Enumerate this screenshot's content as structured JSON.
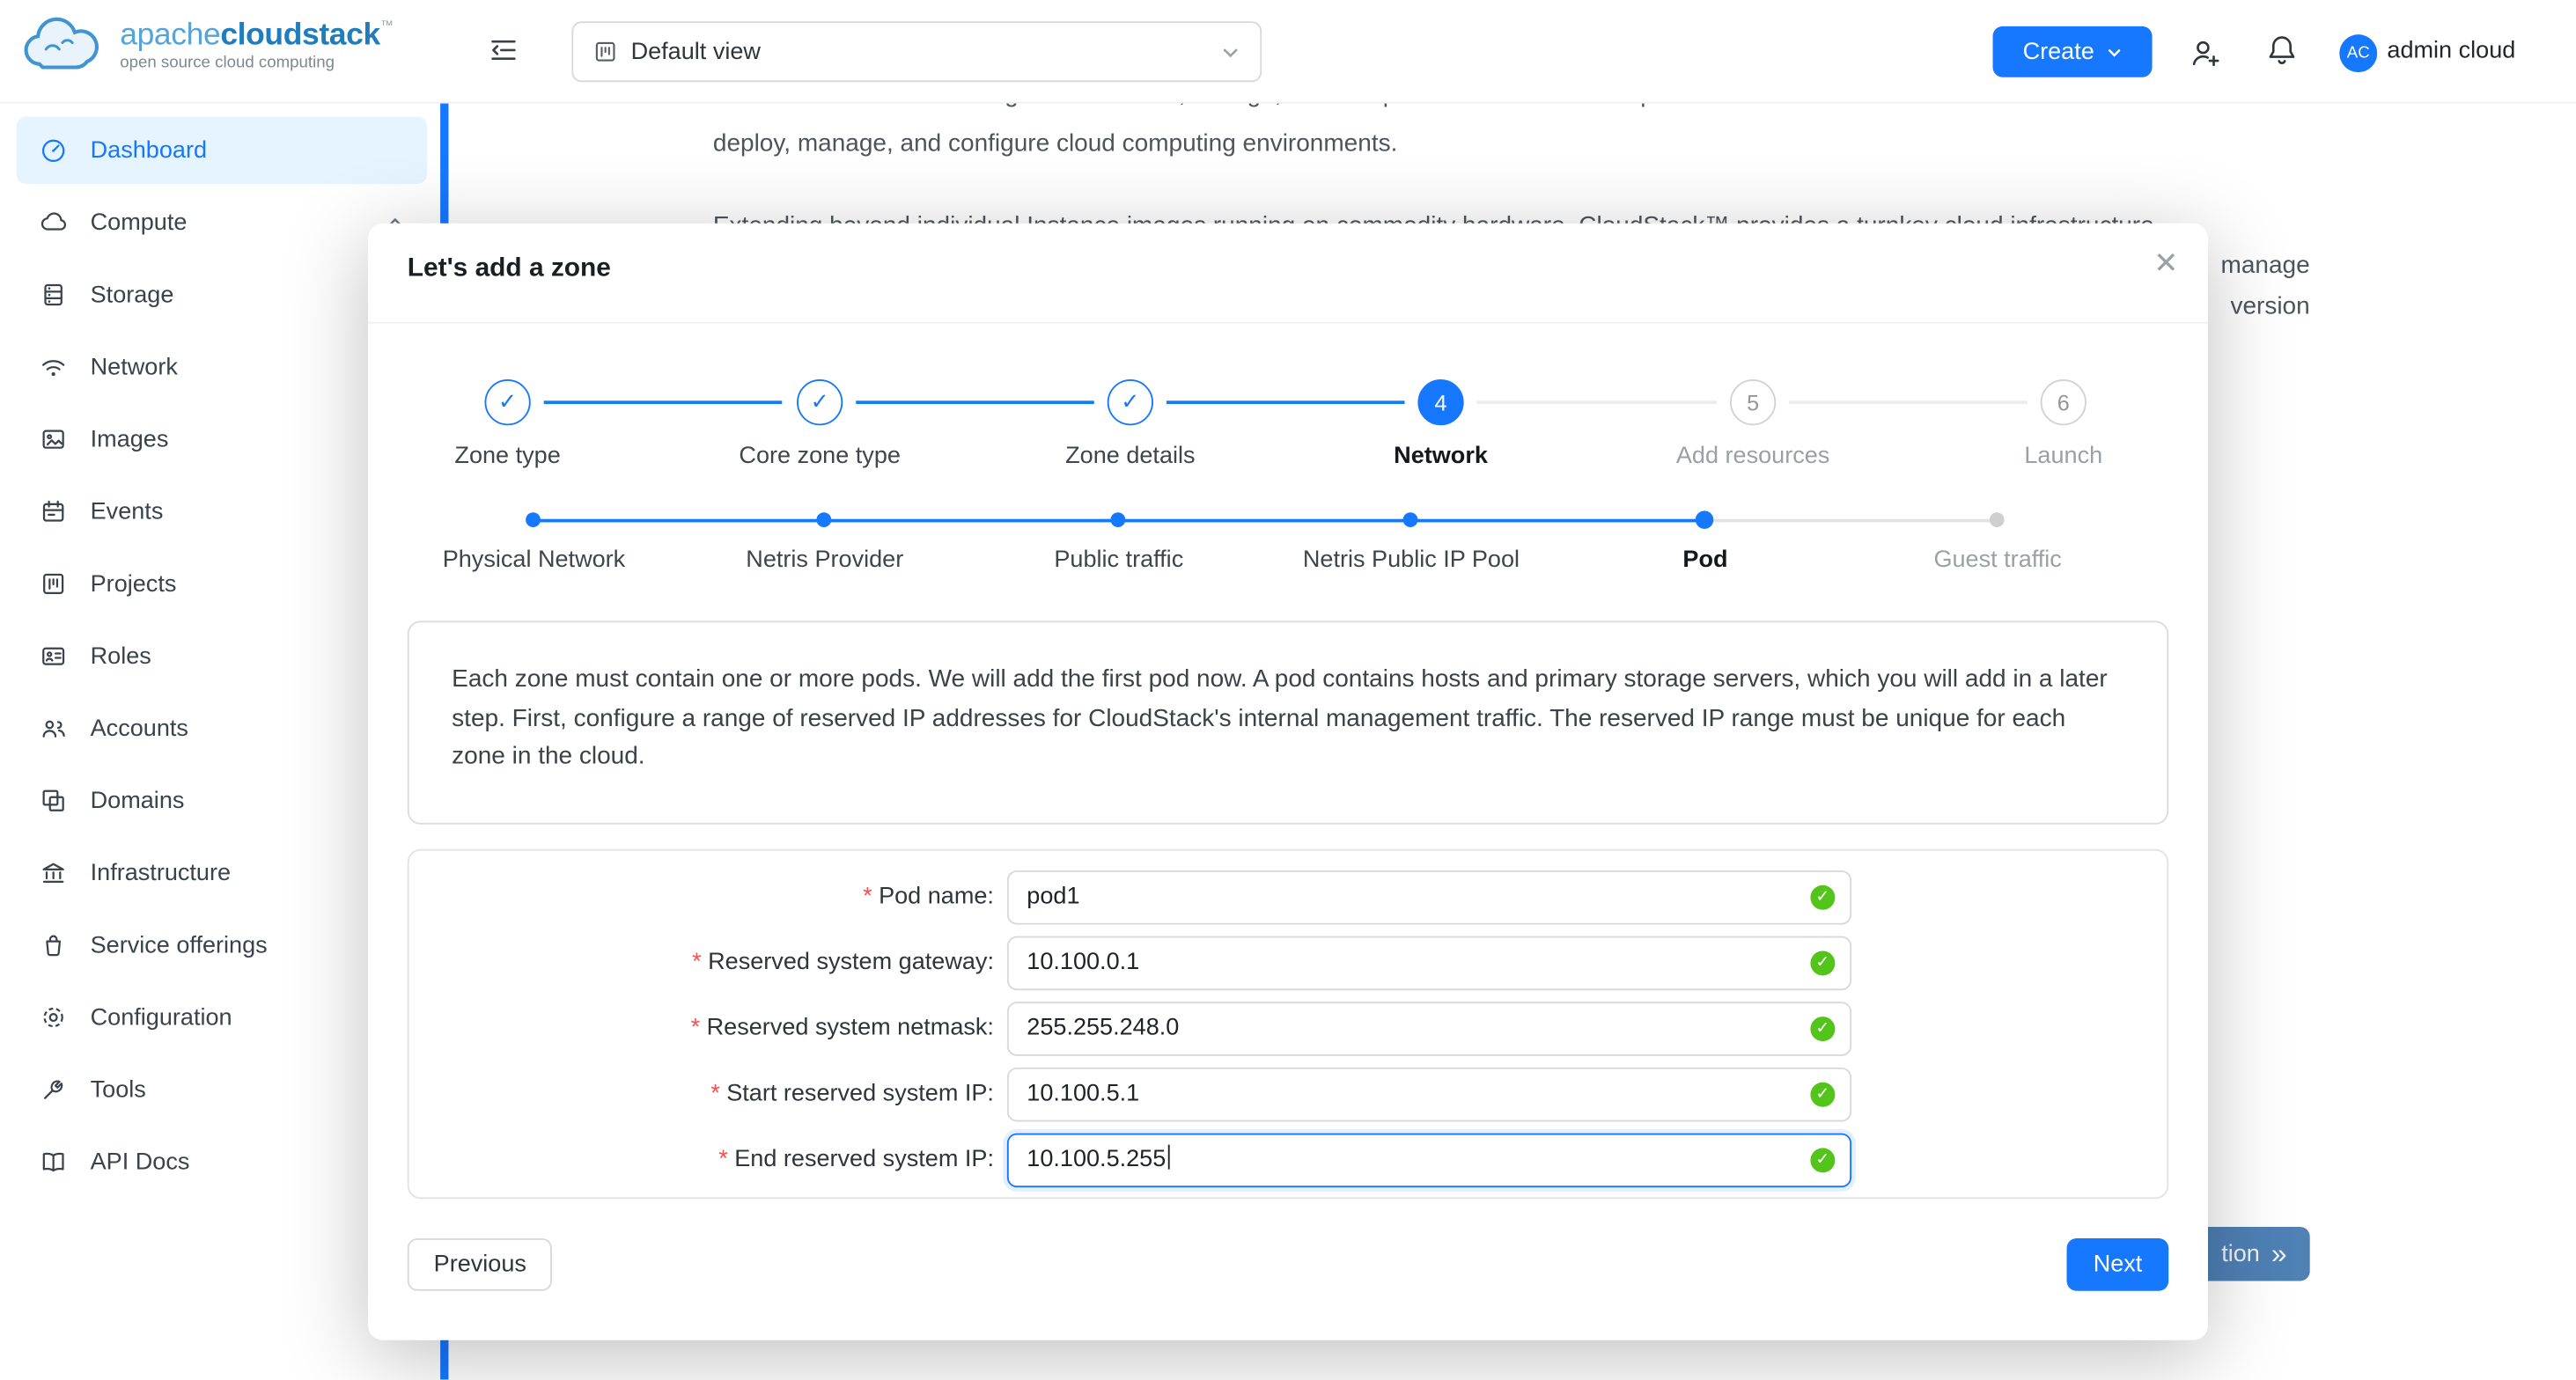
{
  "header": {
    "logo": {
      "apache": "apache",
      "cloudstack": "cloudstack",
      "tm": "™",
      "tagline": "open source cloud computing"
    },
    "view_select": {
      "value": "Default view"
    },
    "create_label": "Create",
    "user": {
      "initials": "AC",
      "name": "admin cloud"
    }
  },
  "sidebar": {
    "items": [
      {
        "label": "Dashboard",
        "icon": "dashboard-icon",
        "active": true
      },
      {
        "label": "Compute",
        "icon": "cloud-icon",
        "expandable": true
      },
      {
        "label": "Storage",
        "icon": "database-icon"
      },
      {
        "label": "Network",
        "icon": "wifi-icon"
      },
      {
        "label": "Images",
        "icon": "picture-icon"
      },
      {
        "label": "Events",
        "icon": "calendar-icon"
      },
      {
        "label": "Projects",
        "icon": "project-icon"
      },
      {
        "label": "Roles",
        "icon": "idcard-icon"
      },
      {
        "label": "Accounts",
        "icon": "team-icon"
      },
      {
        "label": "Domains",
        "icon": "block-icon"
      },
      {
        "label": "Infrastructure",
        "icon": "bank-icon"
      },
      {
        "label": "Service offerings",
        "icon": "bag-icon"
      },
      {
        "label": "Configuration",
        "icon": "gear-icon"
      },
      {
        "label": "Tools",
        "icon": "wrench-icon"
      },
      {
        "label": "API Docs",
        "icon": "book-icon"
      }
    ]
  },
  "background": {
    "line1": "cloud. CloudStack™ manages the network, storage, and compute nodes that make up a cloud infrastructure. Use CloudStack™ to",
    "line2": "deploy, manage, and configure cloud computing environments.",
    "line3": "Extending beyond individual Instance images running on commodity hardware, CloudStack™ provides a turnkey cloud infrastructure",
    "line4_fragment": "manage",
    "line5_fragment": "version",
    "continue_fragment": "tion"
  },
  "icons": {
    "check": "✓",
    "close": "✕",
    "double_chevron": "»"
  },
  "modal": {
    "title": "Let's add a zone",
    "steps": [
      {
        "label": "Zone type",
        "state": "done"
      },
      {
        "label": "Core zone type",
        "state": "done"
      },
      {
        "label": "Zone details",
        "state": "done"
      },
      {
        "label": "Network",
        "state": "current",
        "number": "4"
      },
      {
        "label": "Add resources",
        "state": "wait",
        "number": "5"
      },
      {
        "label": "Launch",
        "state": "wait",
        "number": "6"
      }
    ],
    "substeps": [
      {
        "label": "Physical Network",
        "state": "done"
      },
      {
        "label": "Netris Provider",
        "state": "done"
      },
      {
        "label": "Public traffic",
        "state": "done"
      },
      {
        "label": "Netris Public IP Pool",
        "state": "done"
      },
      {
        "label": "Pod",
        "state": "current"
      },
      {
        "label": "Guest traffic",
        "state": "wait"
      }
    ],
    "info": "Each zone must contain one or more pods. We will add the first pod now. A pod contains hosts and primary storage servers, which you will add in a later step. First, configure a range of reserved IP addresses for CloudStack's internal management traffic. The reserved IP range must be unique for each zone in the cloud.",
    "required_mark": "*",
    "form": [
      {
        "label": "Pod name:",
        "value": "pod1",
        "valid": true
      },
      {
        "label": "Reserved system gateway:",
        "value": "10.100.0.1",
        "valid": true
      },
      {
        "label": "Reserved system netmask:",
        "value": "255.255.248.0",
        "valid": true
      },
      {
        "label": "Start reserved system IP:",
        "value": "10.100.5.1",
        "valid": true
      },
      {
        "label": "End reserved system IP:",
        "value": "10.100.5.255",
        "valid": true,
        "focused": true
      }
    ],
    "previous_label": "Previous",
    "next_label": "Next"
  }
}
